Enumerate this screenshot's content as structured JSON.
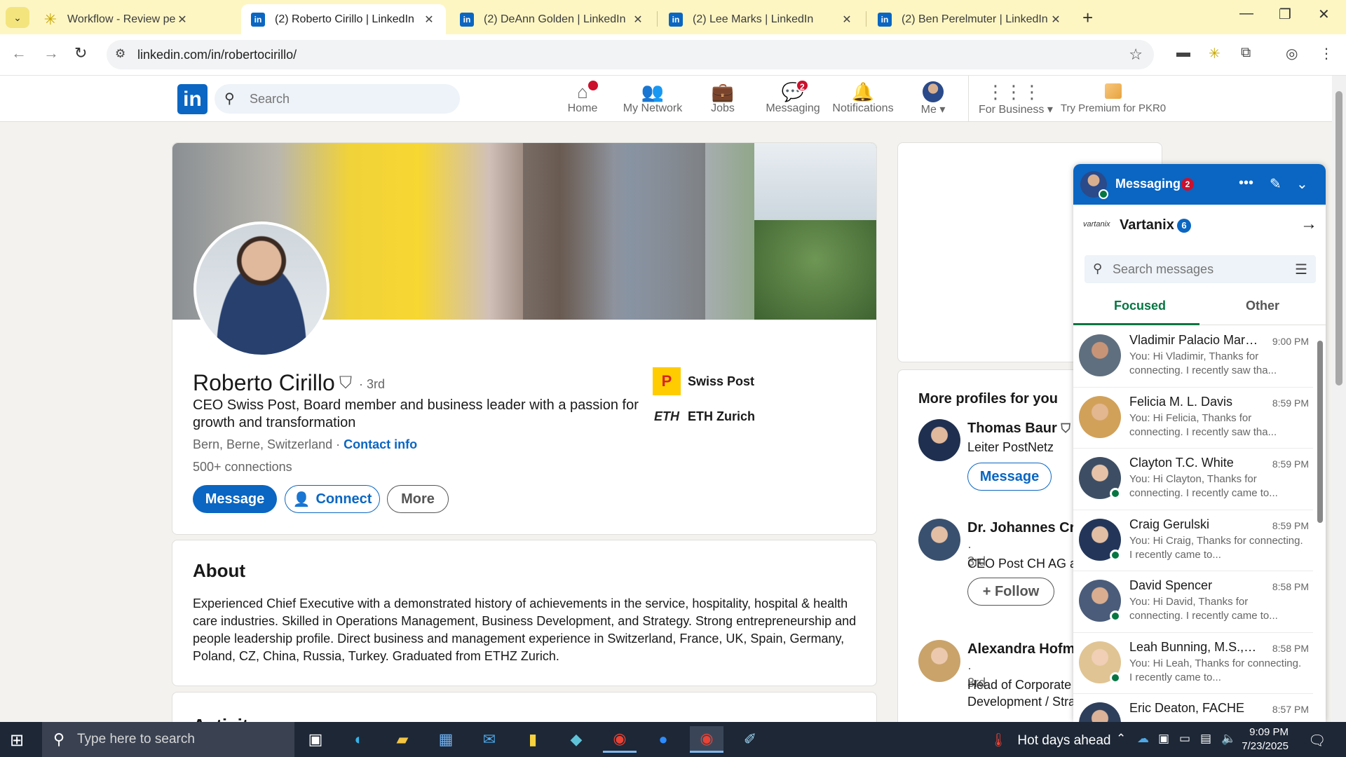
{
  "browser": {
    "tabs": [
      {
        "title": "Workflow - Review pending approvals",
        "icon": "workflow-star-icon"
      },
      {
        "title": "(2) Roberto Cirillo | LinkedIn",
        "icon": "linkedin-icon",
        "active": true
      },
      {
        "title": "(2) DeAnn Golden | LinkedIn",
        "icon": "linkedin-icon"
      },
      {
        "title": "(2) Lee Marks | LinkedIn",
        "icon": "linkedin-icon"
      },
      {
        "title": "(2) Ben Perelmuter | LinkedIn",
        "icon": "linkedin-icon"
      }
    ],
    "url": "linkedin.com/in/robertocirillo/"
  },
  "header": {
    "search_placeholder": "Search",
    "nav": [
      {
        "label": "Home",
        "badge": ""
      },
      {
        "label": "My Network",
        "badge": ""
      },
      {
        "label": "Jobs",
        "badge": ""
      },
      {
        "label": "Messaging",
        "badge": "2"
      },
      {
        "label": "Notifications",
        "badge": ""
      },
      {
        "label": "Me ▾",
        "badge": ""
      },
      {
        "label": "For Business ▾",
        "badge": ""
      },
      {
        "label": "Try Premium for PKR0",
        "badge": ""
      }
    ]
  },
  "profile": {
    "name": "Roberto Cirillo",
    "degree": "· 3rd",
    "headline": "CEO Swiss Post, Board member and business leader with a passion for growth and transformation",
    "location": "Bern, Berne, Switzerland ·",
    "contact_info": "Contact info",
    "connections": "500+ connections",
    "buttons": {
      "message": "Message",
      "connect": "Connect",
      "more": "More"
    },
    "orgs": [
      {
        "name": "Swiss Post",
        "logo": "P"
      },
      {
        "name": "ETH Zurich",
        "logo": "ETH"
      }
    ]
  },
  "about": {
    "title": "About",
    "text": "Experienced Chief Executive with a demonstrated history of achievements in the service, hospitality, hospital & health care industries. Skilled in Operations Management, Business Development, and Strategy. Strong entrepreneurship and people leadership profile. Direct business and management experience in Switzerland, France, UK, Spain, Germany, Poland, CZ, China, Russia, Turkey. Graduated from ETHZ Zurich."
  },
  "activity": {
    "title": "Activity"
  },
  "more_profiles": {
    "title": "More profiles for you",
    "people": [
      {
        "name": "Thomas Baur",
        "degree": "",
        "sub1": "Leiter PostNetz",
        "sub2": "",
        "action": "Message"
      },
      {
        "name": "Dr. Johannes Cra",
        "degree": "· 3rd",
        "sub1": "CEO Post CH AG at",
        "sub2": "",
        "action": "+ Follow"
      },
      {
        "name": "Alexandra Hofma",
        "degree": "· 3rd",
        "sub1": "Head of Corporate",
        "sub2": "Development / Stra",
        "action": ""
      }
    ]
  },
  "messaging": {
    "title": "Messaging",
    "badge": "2",
    "org_name": "Vartanix",
    "org_logo": "vartanix",
    "org_count": "6",
    "search_placeholder": "Search messages",
    "tabs": {
      "focused": "Focused",
      "other": "Other"
    },
    "conversations": [
      {
        "name": "Vladimir Palacio Marti...",
        "time": "9:00 PM",
        "preview": "You: Hi Vladimir, Thanks for connecting. I recently saw tha...",
        "online": false
      },
      {
        "name": "Felicia M. L. Davis",
        "time": "8:59 PM",
        "preview": "You: Hi Felicia, Thanks for connecting. I recently saw tha...",
        "online": false
      },
      {
        "name": "Clayton T.C. White",
        "time": "8:59 PM",
        "preview": "You: Hi Clayton, Thanks for connecting. I recently came to...",
        "online": true
      },
      {
        "name": "Craig Gerulski",
        "time": "8:59 PM",
        "preview": "You: Hi Craig, Thanks for connecting. I recently came to...",
        "online": true
      },
      {
        "name": "David Spencer",
        "time": "8:58 PM",
        "preview": "You: Hi David, Thanks for connecting. I recently came to...",
        "online": true
      },
      {
        "name": "Leah Bunning, M.S., N...",
        "time": "8:58 PM",
        "preview": "You: Hi Leah, Thanks for connecting. I recently came to...",
        "online": true
      },
      {
        "name": "Eric Deaton, FACHE",
        "time": "8:57 PM",
        "preview": "",
        "online": false
      }
    ]
  },
  "taskbar": {
    "search_placeholder": "Type here to search",
    "weather": "Hot days ahead",
    "time": "9:09 PM",
    "date": "7/23/2025"
  },
  "colors": {
    "linkedin_blue": "#0a66c2",
    "badge_red": "#cb112d",
    "online_green": "#057642",
    "tab_strip": "#fdf6c3"
  }
}
